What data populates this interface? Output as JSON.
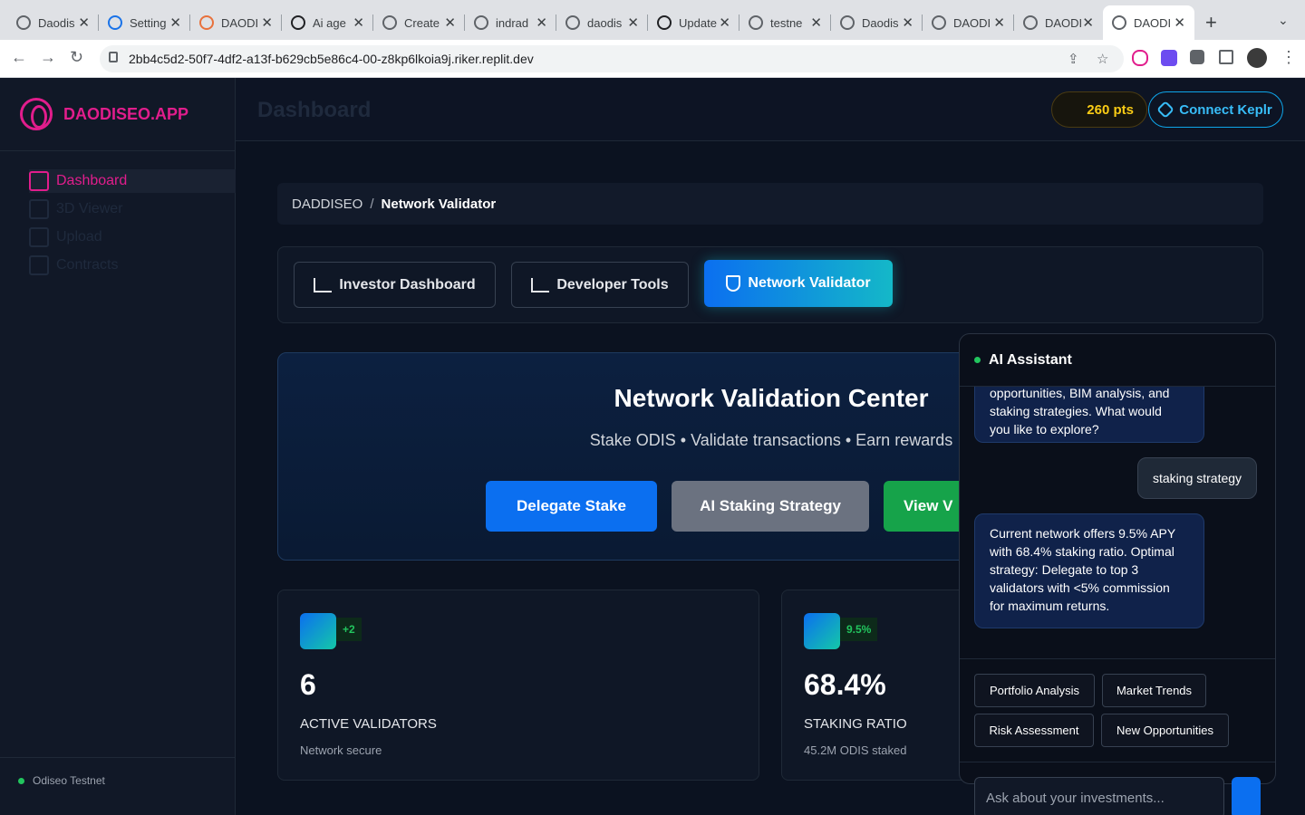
{
  "browser": {
    "tabs": [
      {
        "title": "Daodis"
      },
      {
        "title": "Setting"
      },
      {
        "title": "DAODI"
      },
      {
        "title": "Ai age"
      },
      {
        "title": "Create"
      },
      {
        "title": "indrad"
      },
      {
        "title": "daodis"
      },
      {
        "title": "Update"
      },
      {
        "title": "testne"
      },
      {
        "title": "Daodis"
      },
      {
        "title": "DAODI"
      },
      {
        "title": "DAODI"
      },
      {
        "title": "DAODI"
      }
    ],
    "url": "2bb4c5d2-50f7-4df2-a13f-b629cb5e86c4-00-z8kp6lkoia9j.riker.replit.dev"
  },
  "sidebar": {
    "logo_text": "DAODISEO.APP",
    "items": [
      {
        "label": "Dashboard",
        "icon": "grid-icon"
      },
      {
        "label": "3D Viewer",
        "icon": "cube-icon"
      },
      {
        "label": "Upload",
        "icon": "upload-icon"
      },
      {
        "label": "Contracts",
        "icon": "document-icon"
      }
    ],
    "network": "Odiseo Testnet"
  },
  "header": {
    "title": "Dashboard",
    "points": "260 pts",
    "connect_label": "Connect Keplr"
  },
  "breadcrumb": {
    "root": "DADDISEO",
    "separator": "/",
    "current": "Network Validator"
  },
  "view_tabs": [
    {
      "label": "Investor Dashboard",
      "icon": "trend-icon"
    },
    {
      "label": "Developer Tools",
      "icon": "upload-icon"
    },
    {
      "label": "Network Validator",
      "icon": "shield-icon"
    }
  ],
  "hero": {
    "title": "Network Validation Center",
    "subtitle": "Stake ODIS • Validate transactions • Earn rewards",
    "buttons": [
      "Delegate Stake",
      "AI Staking Strategy",
      "View V"
    ]
  },
  "stats": [
    {
      "badge": "+2",
      "value": "6",
      "label": "ACTIVE VALIDATORS",
      "note": "Network secure"
    },
    {
      "badge": "9.5%",
      "value": "68.4%",
      "label": "STAKING RATIO",
      "note": "45.2M ODIS staked"
    }
  ],
  "assistant": {
    "title": "AI Assistant",
    "messages": [
      {
        "role": "bot",
        "lines": [
          "opportunities, BIM analysis, and",
          "staking strategies. What would",
          "you like to explore?"
        ]
      },
      {
        "role": "user",
        "text": "staking strategy"
      },
      {
        "role": "bot",
        "lines": [
          "Current network offers 9.5% APY",
          "with 68.4% staking ratio. Optimal",
          "strategy: Delegate to top 3",
          "validators with <5% commission",
          "for maximum returns."
        ]
      }
    ],
    "quick_actions": [
      "Portfolio Analysis",
      "Market Trends",
      "Risk Assessment",
      "New Opportunities"
    ],
    "input_placeholder": "Ask about your investments..."
  },
  "colors": {
    "accent": "#e11d8c",
    "primary": "#0b6ff0",
    "success": "#22c55e",
    "points": "#facc15"
  }
}
